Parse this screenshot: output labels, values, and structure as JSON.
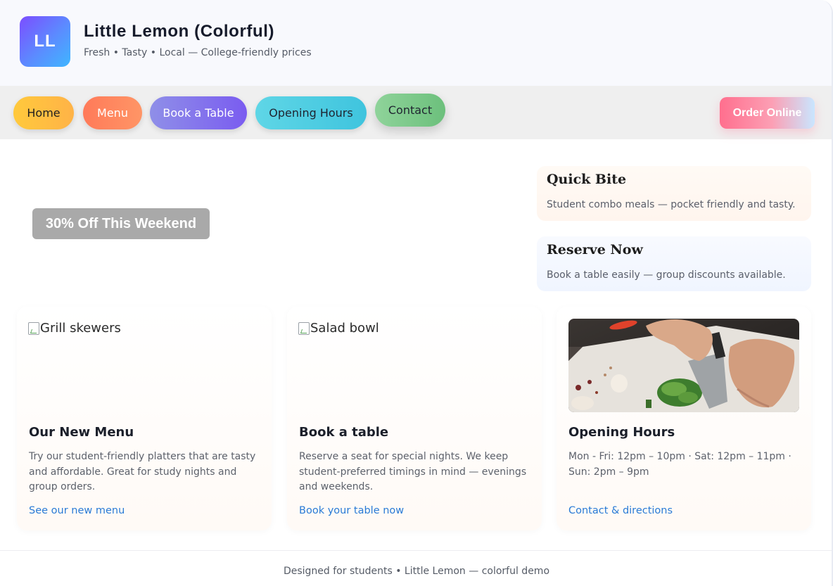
{
  "brand": {
    "logo_text": "LL",
    "title": "Little Lemon (Colorful)",
    "tagline": "Fresh • Tasty • Local — College-friendly prices"
  },
  "nav": {
    "items": [
      {
        "label": "Home"
      },
      {
        "label": "Menu"
      },
      {
        "label": "Book a Table"
      },
      {
        "label": "Opening Hours"
      },
      {
        "label": "Contact"
      }
    ],
    "order_label": "Order Online"
  },
  "promo": {
    "label": "30% Off This Weekend"
  },
  "side_cards": [
    {
      "title": "Quick Bite",
      "text": "Student combo meals — pocket friendly and tasty."
    },
    {
      "title": "Reserve Now",
      "text": "Book a table easily — group discounts available."
    }
  ],
  "cards": [
    {
      "image_alt": "Grill skewers",
      "title": "Our New Menu",
      "text": "Try our student-friendly platters that are tasty and affordable. Great for study nights and group orders.",
      "link": "See our new menu"
    },
    {
      "image_alt": "Salad bowl",
      "title": "Book a table",
      "text": "Reserve a seat for special nights. We keep student-preferred timings in mind — evenings and weekends.",
      "link": "Book your table now"
    },
    {
      "title": "Opening Hours",
      "text": "Mon - Fri: 12pm – 10pm · Sat: 12pm – 11pm · Sun: 2pm – 9pm",
      "link": "Contact & directions"
    }
  ],
  "footer": {
    "text": "Designed for students • Little Lemon — colorful demo"
  },
  "colors": {
    "link": "#2a7bd6",
    "logo_gradient_start": "#7c4dff",
    "logo_gradient_end": "#3fb6ff",
    "nav_bg": "#efefef"
  }
}
